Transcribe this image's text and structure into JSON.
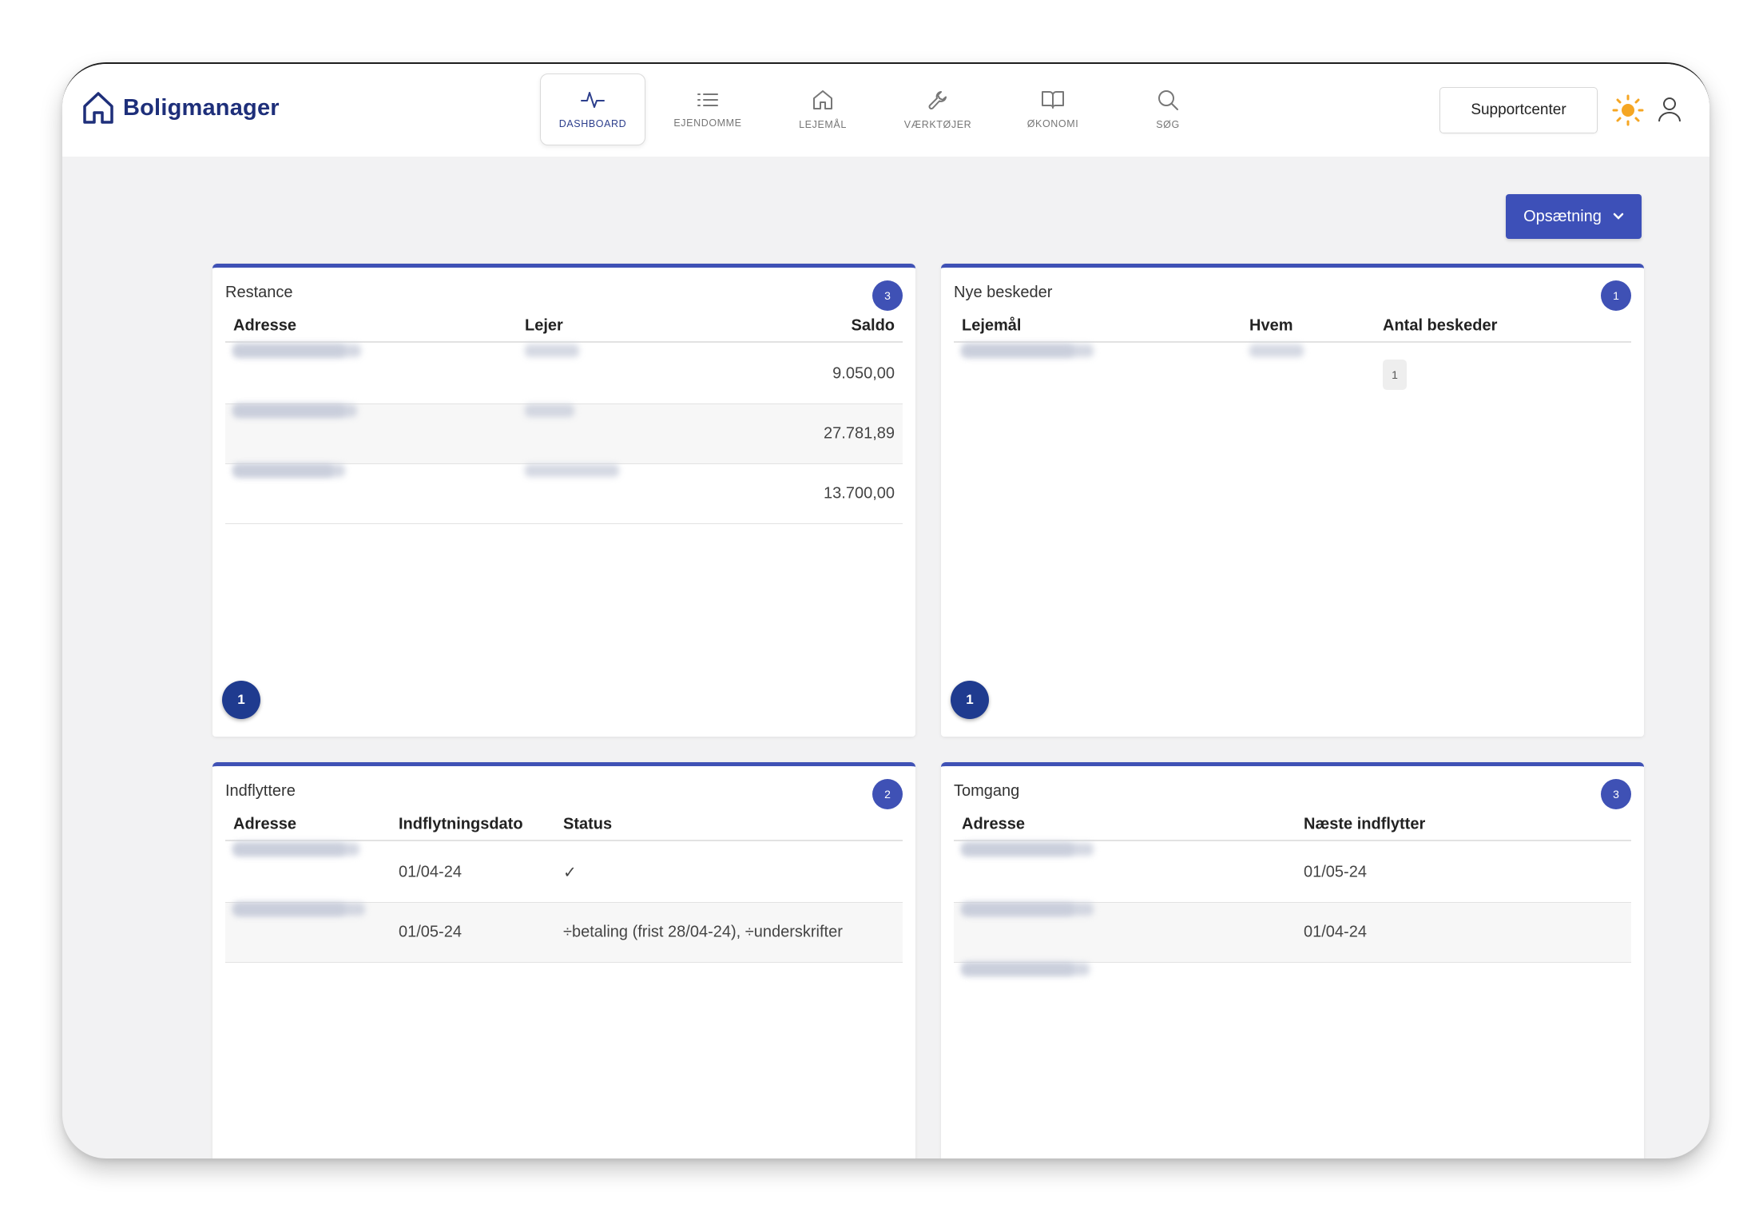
{
  "brand": {
    "name": "Boligmanager"
  },
  "nav": [
    {
      "label": "DASHBOARD",
      "icon": "activity-icon",
      "active": true
    },
    {
      "label": "EJENDOMME",
      "icon": "list-icon",
      "active": false
    },
    {
      "label": "LEJEMÅL",
      "icon": "house-icon",
      "active": false
    },
    {
      "label": "VÆRKTØJER",
      "icon": "wrench-icon",
      "active": false
    },
    {
      "label": "ØKONOMI",
      "icon": "book-icon",
      "active": false
    },
    {
      "label": "SØG",
      "icon": "search-icon",
      "active": false
    }
  ],
  "header": {
    "support_label": "Supportcenter"
  },
  "toolbar": {
    "setup_label": "Opsætning"
  },
  "colors": {
    "accent": "#3f51b5",
    "brand": "#1e2f7a",
    "pager": "#1f3b8f",
    "sun": "#f5a623"
  },
  "restance": {
    "title": "Restance",
    "count": "3",
    "columns": [
      "Adresse",
      "Lejer",
      "Saldo"
    ],
    "rows": [
      {
        "saldo": "9.050,00"
      },
      {
        "saldo": "27.781,89"
      },
      {
        "saldo": "13.700,00"
      }
    ],
    "page": "1"
  },
  "beskeder": {
    "title": "Nye beskeder",
    "count": "1",
    "columns": [
      "Lejemål",
      "Hvem",
      "Antal beskeder"
    ],
    "rows": [
      {
        "antal": "1"
      }
    ],
    "page": "1"
  },
  "indflyttere": {
    "title": "Indflyttere",
    "count": "2",
    "columns": [
      "Adresse",
      "Indflytningsdato",
      "Status"
    ],
    "rows": [
      {
        "dato": "01/04-24",
        "status": "✓"
      },
      {
        "dato": "01/05-24",
        "status": "÷betaling (frist 28/04-24), ÷underskrifter"
      }
    ]
  },
  "tomgang": {
    "title": "Tomgang",
    "count": "3",
    "columns": [
      "Adresse",
      "Næste indflytter"
    ],
    "rows": [
      {
        "naeste": "01/05-24"
      },
      {
        "naeste": "01/04-24"
      },
      {
        "naeste": ""
      }
    ]
  }
}
